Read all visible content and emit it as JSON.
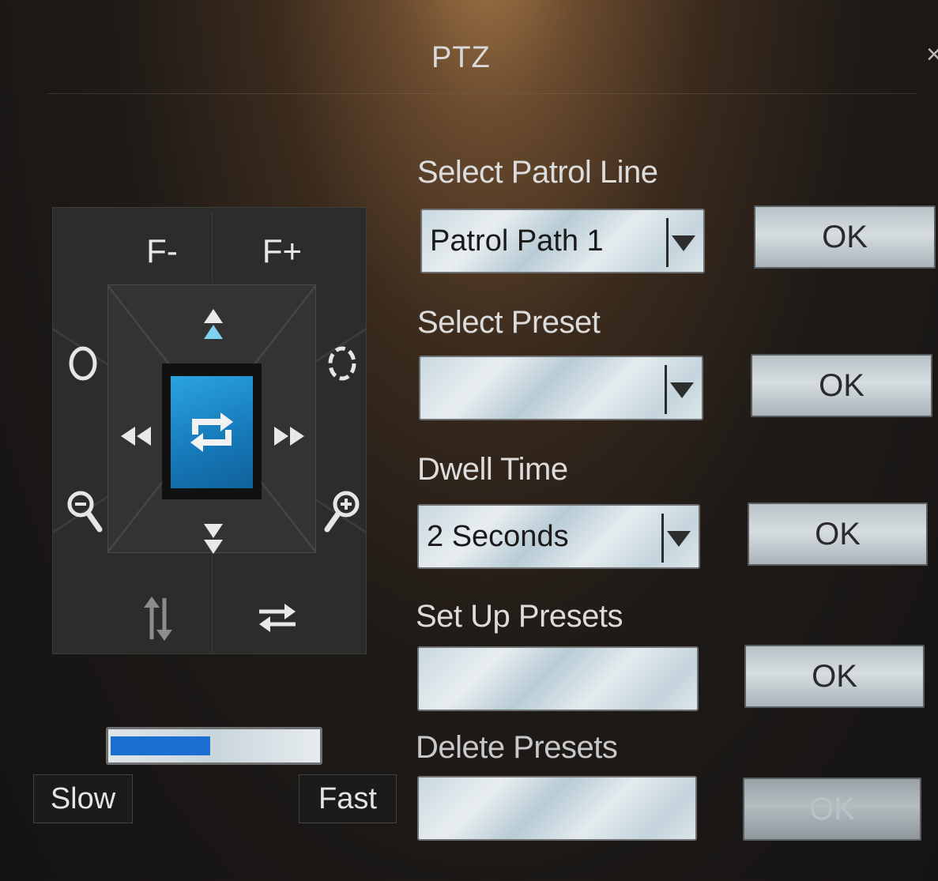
{
  "window": {
    "title": "PTZ",
    "close_symbol": "×"
  },
  "pad": {
    "focus_minus_label": "F-",
    "focus_plus_label": "F+",
    "icons": [
      "iris-close-icon",
      "iris-open-icon",
      "zoom-out-icon",
      "zoom-in-icon",
      "tilt-up-icon",
      "tilt-down-icon",
      "pan-left-icon",
      "pan-right-icon",
      "auto-scan-icon",
      "flip-vertical-icon",
      "swap-horizontal-icon"
    ]
  },
  "speed": {
    "level_fraction": 0.48,
    "slow_label": "Slow",
    "fast_label": "Fast"
  },
  "form": {
    "patrol_line": {
      "label": "Select Patrol Line",
      "value": "Patrol Path 1",
      "ok_label": "OK"
    },
    "preset": {
      "label": "Select Preset",
      "value": "",
      "ok_label": "OK"
    },
    "dwell_time": {
      "label": "Dwell Time",
      "value": "2 Seconds",
      "ok_label": "OK"
    },
    "setup_presets": {
      "label": "Set Up Presets",
      "value": "",
      "ok_label": "OK"
    },
    "delete_presets": {
      "label": "Delete Presets",
      "value": "",
      "ok_label": "OK"
    }
  },
  "colors": {
    "accent": "#1c78c0",
    "speed_fill": "#1c6fd0",
    "field_bg": "#d6e2e8"
  }
}
